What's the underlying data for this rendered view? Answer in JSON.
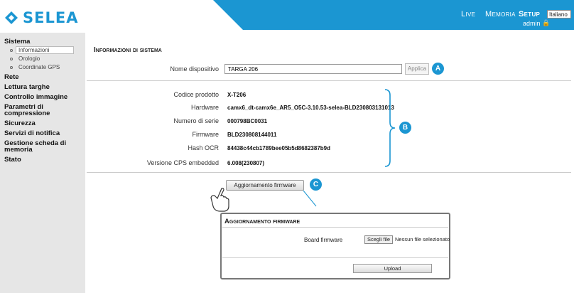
{
  "brand": {
    "logo_text": "SELEA",
    "color": "#1b96d2"
  },
  "header": {
    "nav": {
      "live": "Live",
      "memoria": "Memoria",
      "setup": "Setup"
    },
    "language": "Italiano",
    "user": "admin",
    "lock_icon": "lock-icon"
  },
  "sidebar": {
    "sistema": "Sistema",
    "sub_informazioni": "Informazioni",
    "sub_orologio": "Orologio",
    "sub_coordinate": "Coordinate GPS",
    "rete": "Rete",
    "lettura": "Lettura targhe",
    "controllo": "Controllo immagine",
    "parametri_1": "Parametri di",
    "parametri_2": "compressione",
    "sicurezza": "Sicurezza",
    "servizi": "Servizi di notifica",
    "gestione_1": "Gestione scheda di",
    "gestione_2": "memoria",
    "stato": "Stato"
  },
  "main": {
    "title": "Informazioni di sistema",
    "device_name_label": "Nome dispositivo",
    "device_name_value": "TARGA 206",
    "apply_label": "Applica",
    "fields": {
      "codice_label": "Codice prodotto",
      "codice_value": "X-T206",
      "hardware_label": "Hardware",
      "hardware_value": "camx6_dt-camx6e_AR5_O5C-3.10.53-selea-BLD230803131013",
      "serie_label": "Numero di serie",
      "serie_value": "000798BC0031",
      "firmware_label": "Firmware",
      "firmware_value": "BLD230808144011",
      "ocr_label": "Hash OCR",
      "ocr_value": "84438c44cb1789bee05b5d8682387b9d",
      "cps_label": "Versione CPS embedded",
      "cps_value": "6.008(230807)"
    },
    "fw_button_label": "Aggiornamento firmware"
  },
  "badges": {
    "a": "A",
    "b": "B",
    "c": "C"
  },
  "popup": {
    "title": "Aggiornamento firmware",
    "board_label": "Board firmware",
    "choose_file_label": "Scegli file",
    "no_file_text": "Nessun file selezionato",
    "upload_label": "Upload"
  }
}
